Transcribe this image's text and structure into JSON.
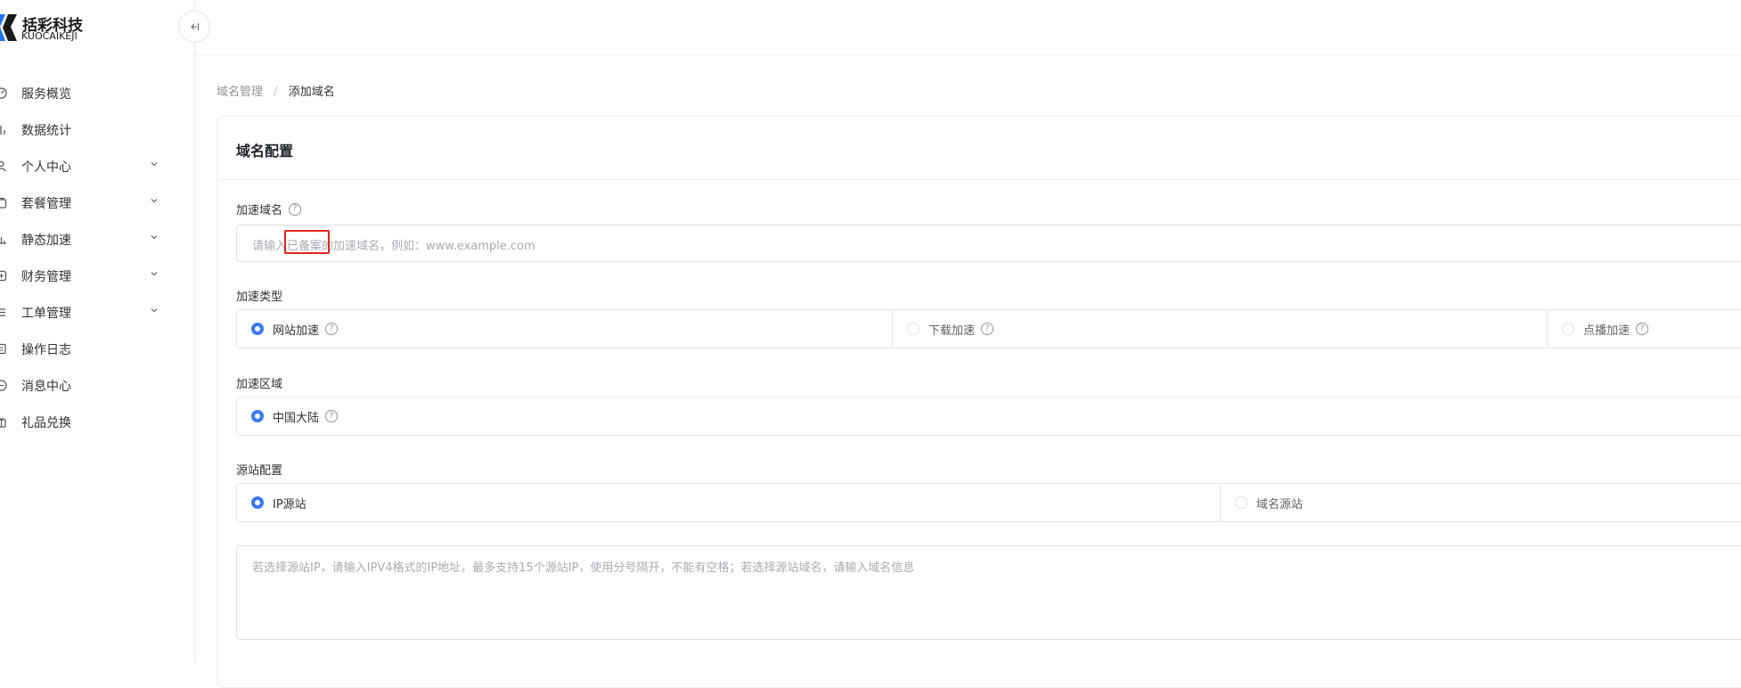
{
  "brand": {
    "name_cn": "括彩科技",
    "name_en": "KUOCAIKEJI",
    "accent": "#1976f0"
  },
  "sidebar": {
    "collapse_icon": "collapse-left-icon",
    "items": [
      {
        "label": "服务概览",
        "icon": "dashboard-icon",
        "has_arrow": false
      },
      {
        "label": "数据统计",
        "icon": "chart-icon",
        "has_arrow": false
      },
      {
        "label": "个人中心",
        "icon": "user-icon",
        "has_arrow": true
      },
      {
        "label": "套餐管理",
        "icon": "package-icon",
        "has_arrow": true
      },
      {
        "label": "静态加速",
        "icon": "accelerate-icon",
        "has_arrow": true
      },
      {
        "label": "财务管理",
        "icon": "finance-icon",
        "has_arrow": true
      },
      {
        "label": "工单管理",
        "icon": "ticket-icon",
        "has_arrow": true
      },
      {
        "label": "操作日志",
        "icon": "log-icon",
        "has_arrow": false
      },
      {
        "label": "消息中心",
        "icon": "message-icon",
        "has_arrow": false
      },
      {
        "label": "礼品兑换",
        "icon": "gift-icon",
        "has_arrow": false
      }
    ]
  },
  "breadcrumb": {
    "parent": "域名管理",
    "separator": "/",
    "current": "添加域名"
  },
  "card": {
    "title": "域名配置",
    "domain": {
      "label": "加速域名",
      "placeholder": "请输入已备案的加速域名，例如：www.example.com"
    },
    "accel_type": {
      "label": "加速类型",
      "options": [
        {
          "label": "网站加速",
          "checked": true
        },
        {
          "label": "下载加速",
          "checked": false
        },
        {
          "label": "点播加速",
          "checked": false
        }
      ]
    },
    "accel_region": {
      "label": "加速区域",
      "options": [
        {
          "label": "中国大陆",
          "checked": true
        }
      ]
    },
    "origin": {
      "label": "源站配置",
      "options": [
        {
          "label": "IP源站",
          "checked": true
        },
        {
          "label": "域名源站",
          "checked": false
        }
      ],
      "placeholder": "若选择源站IP，请输入IPV4格式的IP地址，最多支持15个源站IP，使用分号隔开，不能有空格；若选择源站域名，请输入域名信息"
    }
  },
  "colors": {
    "primary": "#3a78f2",
    "highlight": "#e0241c"
  }
}
